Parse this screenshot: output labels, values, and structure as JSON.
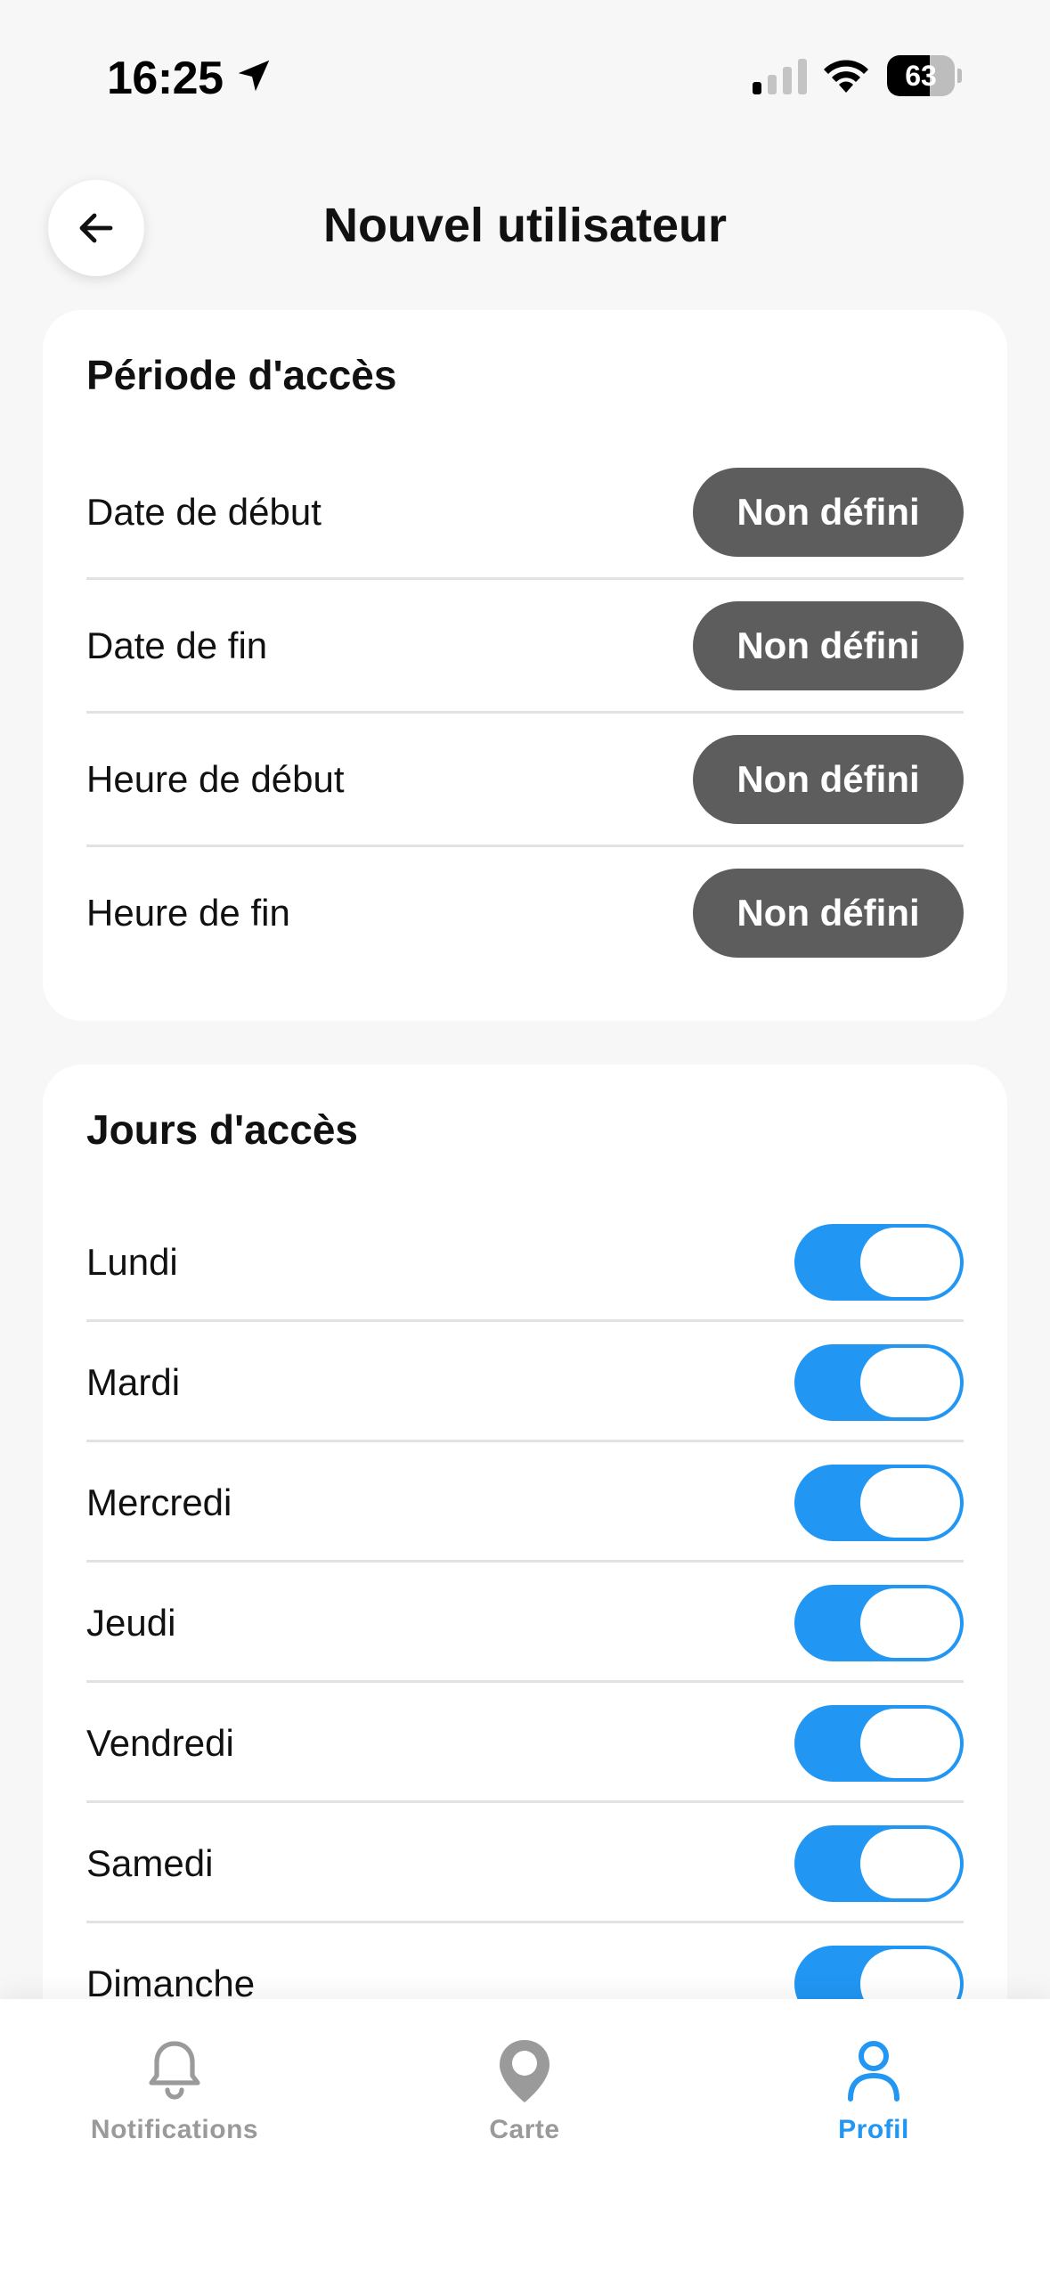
{
  "status_bar": {
    "time": "16:25",
    "battery": "63",
    "battery_level": 0.63
  },
  "header": {
    "title": "Nouvel utilisateur",
    "back_icon": "arrow-left-icon"
  },
  "period": {
    "title": "Période d'accès",
    "rows": [
      {
        "label": "Date de début",
        "value": "Non défini"
      },
      {
        "label": "Date de fin",
        "value": "Non défini"
      },
      {
        "label": "Heure de début",
        "value": "Non défini"
      },
      {
        "label": "Heure de fin",
        "value": "Non défini"
      }
    ]
  },
  "days": {
    "title": "Jours d'accès",
    "items": [
      {
        "label": "Lundi",
        "enabled": true
      },
      {
        "label": "Mardi",
        "enabled": true
      },
      {
        "label": "Mercredi",
        "enabled": true
      },
      {
        "label": "Jeudi",
        "enabled": true
      },
      {
        "label": "Vendredi",
        "enabled": true
      },
      {
        "label": "Samedi",
        "enabled": true
      },
      {
        "label": "Dimanche",
        "enabled": true
      }
    ]
  },
  "tabbar": {
    "tabs": [
      {
        "label": "Notifications",
        "icon": "bell-icon",
        "active": false
      },
      {
        "label": "Carte",
        "icon": "map-pin-icon",
        "active": false
      },
      {
        "label": "Profil",
        "icon": "user-icon",
        "active": true
      }
    ]
  },
  "colors": {
    "accent": "#2196f3",
    "pill": "#5d5d5d",
    "inactive_tab": "#9a9a9a",
    "background": "#f7f7f7"
  }
}
